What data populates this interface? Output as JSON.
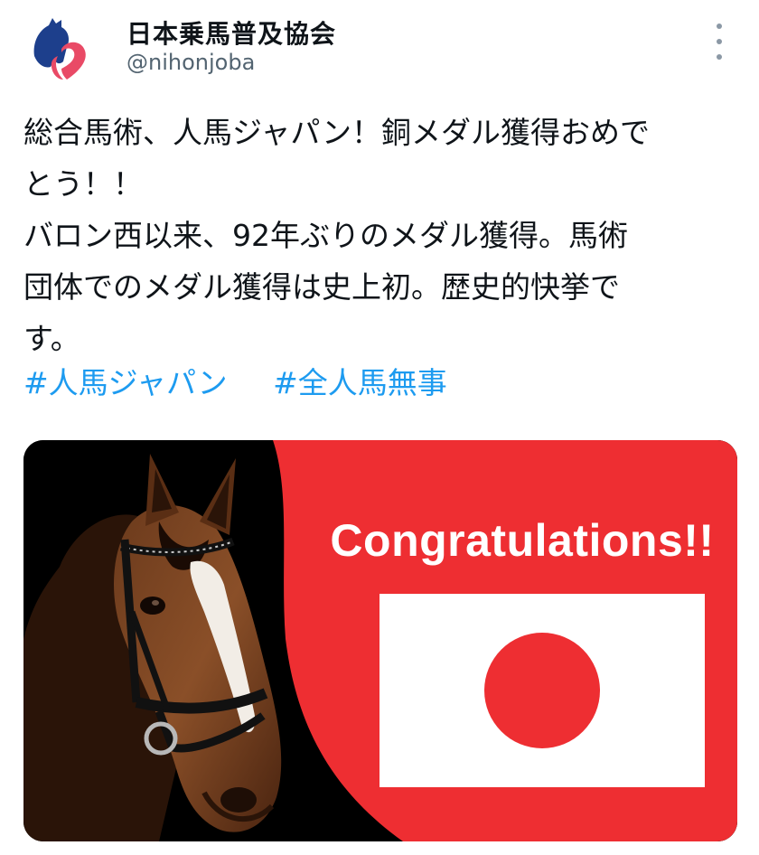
{
  "account": {
    "display_name": "日本乗馬普及協会",
    "handle": "@nihonjoba"
  },
  "tweet": {
    "lines": [
      "総合馬術、人馬ジャパン！銅メダル獲得おめで",
      "とう！！",
      "バロン西以来、92年ぶりのメダル獲得。馬術",
      "団体でのメダル獲得は史上初。歴史的快挙で",
      "す。"
    ],
    "hashtags": [
      "#人馬ジャパン",
      "#全人馬無事"
    ]
  },
  "media": {
    "caption": "Congratulations!!",
    "description": "horse-and-japan-flag-image"
  },
  "colors": {
    "hashtag": "#1d9bf0",
    "banner_red": "#ee2e32",
    "handle_gray": "#536471",
    "avatar_navy": "#1d3f8c",
    "avatar_pink": "#e94a66"
  }
}
